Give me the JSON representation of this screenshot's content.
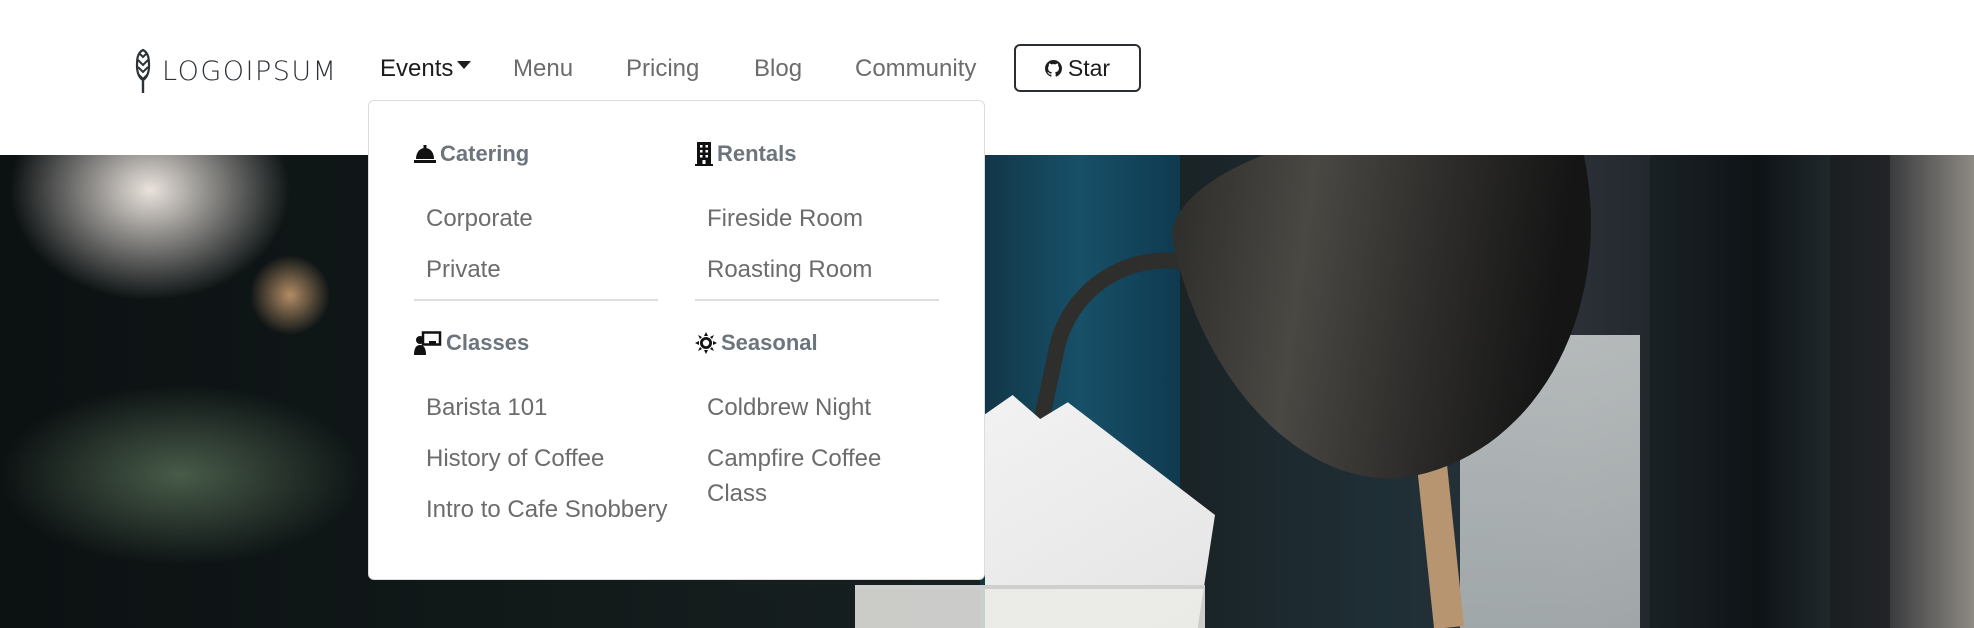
{
  "brand": {
    "name": "LOGOIPSUM",
    "icon": "wheat-icon"
  },
  "nav": {
    "items": [
      {
        "label": "Events",
        "active": true,
        "has_dropdown": true
      },
      {
        "label": "Menu",
        "active": false
      },
      {
        "label": "Pricing",
        "active": false
      },
      {
        "label": "Blog",
        "active": false
      },
      {
        "label": "Community",
        "active": false
      }
    ],
    "star_button": {
      "label": "Star",
      "icon": "github-icon"
    }
  },
  "dropdown": {
    "sections": [
      {
        "title": "Catering",
        "icon": "bell-icon",
        "items": [
          "Corporate",
          "Private"
        ]
      },
      {
        "title": "Rentals",
        "icon": "building-icon",
        "items": [
          "Fireside Room",
          "Roasting Room"
        ]
      },
      {
        "title": "Classes",
        "icon": "teacher-icon",
        "items": [
          "Barista 101",
          "History of Coffee",
          "Intro to Cafe Snobbery"
        ]
      },
      {
        "title": "Seasonal",
        "icon": "sun-icon",
        "items": [
          "Coldbrew Night",
          "Campfire Coffee Class"
        ]
      }
    ]
  },
  "colors": {
    "nav_text": "#6c6c6c",
    "nav_active": "#1c1c1c",
    "section_header": "#6c757d",
    "dropdown_border": "#dcdcdc"
  }
}
